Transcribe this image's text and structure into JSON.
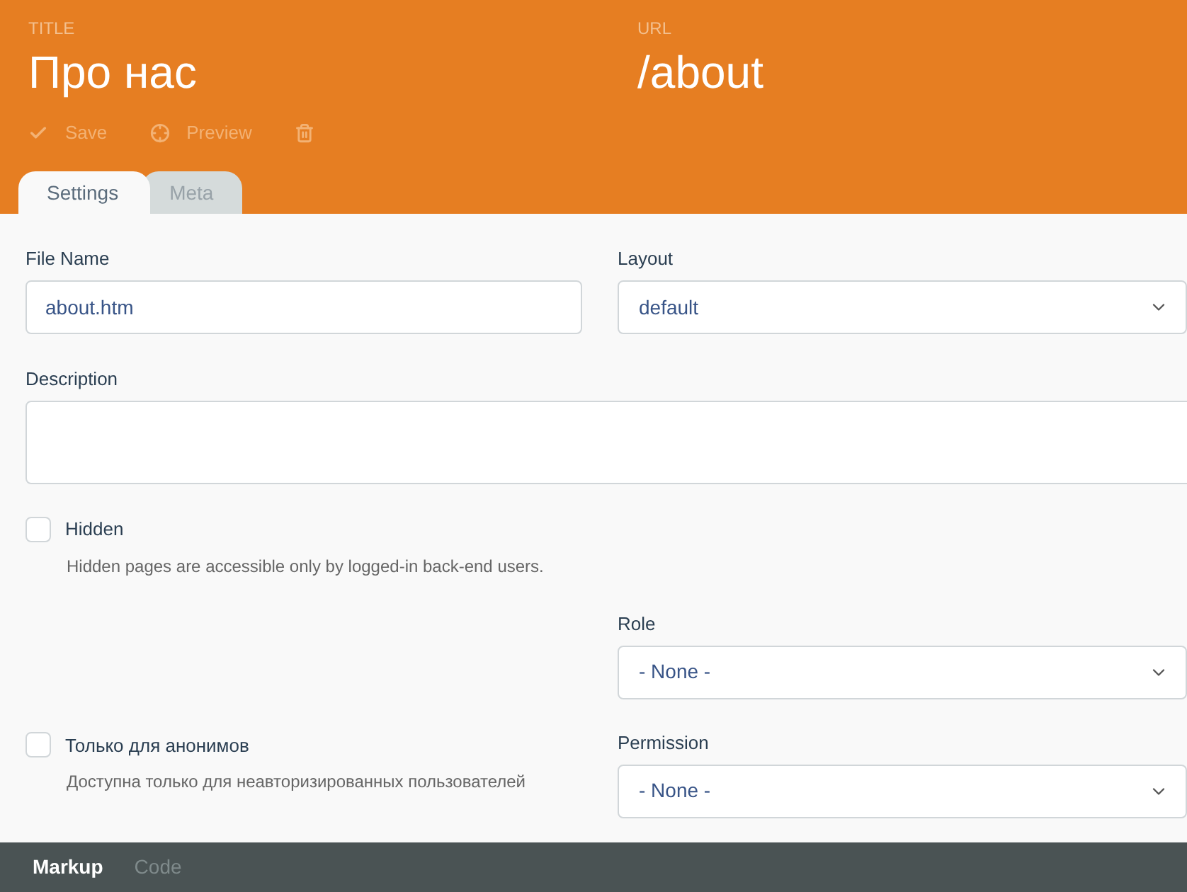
{
  "header": {
    "title_label": "TITLE",
    "title": "Про нас",
    "url_label": "URL",
    "url": "/about",
    "toolbar": [
      {
        "kind": "save",
        "label": "Save"
      },
      {
        "kind": "preview",
        "label": "Preview"
      },
      {
        "kind": "delete"
      }
    ]
  },
  "tabs": [
    {
      "label": "Settings",
      "selected": true
    },
    {
      "label": "Meta",
      "selected": false
    }
  ],
  "form": {
    "file_name": {
      "label": "File Name",
      "value": "about.htm"
    },
    "layout": {
      "label": "Layout",
      "value": "default"
    },
    "description": {
      "label": "Description"
    },
    "hidden": {
      "label": "Hidden",
      "checked": false,
      "help": "Hidden pages are accessible only by logged-in back-end users."
    },
    "role": {
      "label": "Role",
      "value": "- None -"
    },
    "anonymous": {
      "label": "Только для анонимов",
      "checked": false,
      "help": "Доступна только для неавторизированных пользователей"
    },
    "permission": {
      "label": "Permission",
      "value": "- None -"
    }
  },
  "bottom_tabs": [
    {
      "label": "Markup",
      "selected": true
    },
    {
      "label": "Code",
      "selected": false
    }
  ]
}
